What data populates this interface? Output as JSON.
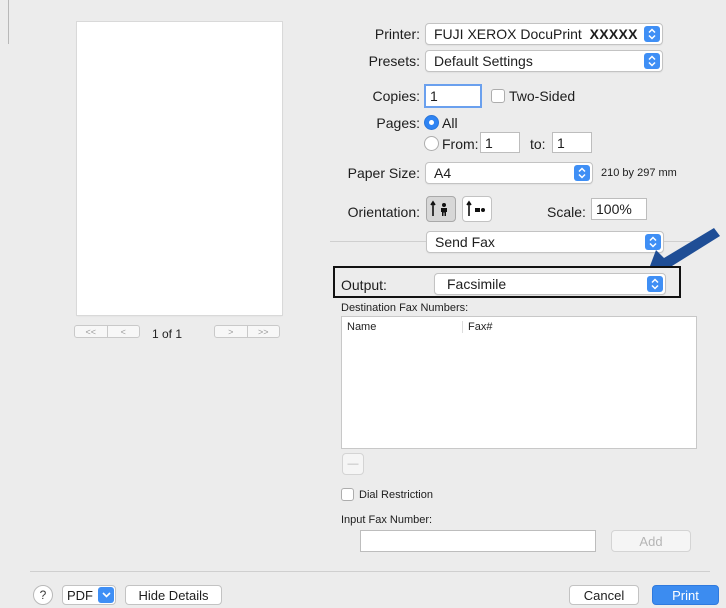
{
  "preview": {
    "page_indicator": "1 of 1",
    "first_glyph": "<<",
    "prev_glyph": "<",
    "next_glyph": ">",
    "last_glyph": ">>"
  },
  "printer": {
    "label": "Printer:",
    "value": "FUJI XEROX DocuPrint",
    "model": "XXXXX"
  },
  "presets": {
    "label": "Presets:",
    "value": "Default Settings"
  },
  "copies": {
    "label": "Copies:",
    "value": "1",
    "two_sided_label": "Two-Sided"
  },
  "pages": {
    "label": "Pages:",
    "all_label": "All",
    "from_label": "From:",
    "from_value": "1",
    "to_label": "to:",
    "to_value": "1"
  },
  "paper": {
    "label": "Paper Size:",
    "value": "A4",
    "dimensions": "210 by 297 mm"
  },
  "orientation": {
    "label": "Orientation:",
    "scale_label": "Scale:",
    "scale_value": "100%"
  },
  "section": {
    "value": "Send Fax"
  },
  "output": {
    "label": "Output:",
    "value": "Facsimile"
  },
  "destination": {
    "label": "Destination Fax Numbers:",
    "col_name": "Name",
    "col_fax": "Fax#",
    "remove_glyph": "—"
  },
  "dial_restriction": {
    "label": "Dial Restriction"
  },
  "input_fax": {
    "label": "Input Fax Number:",
    "value": "",
    "add_label": "Add"
  },
  "footer": {
    "help_glyph": "?",
    "pdf_label": "PDF",
    "hide_details_label": "Hide Details",
    "cancel_label": "Cancel",
    "print_label": "Print"
  },
  "colors": {
    "accent": "#3f8ff5",
    "arrow": "#1f4e96",
    "highlight_box": "#111111"
  },
  "icons": [
    "up-down-chevrons-icon",
    "portrait-icon",
    "landscape-icon",
    "arrow-pointer-icon",
    "help-icon",
    "chevron-down-icon"
  ]
}
